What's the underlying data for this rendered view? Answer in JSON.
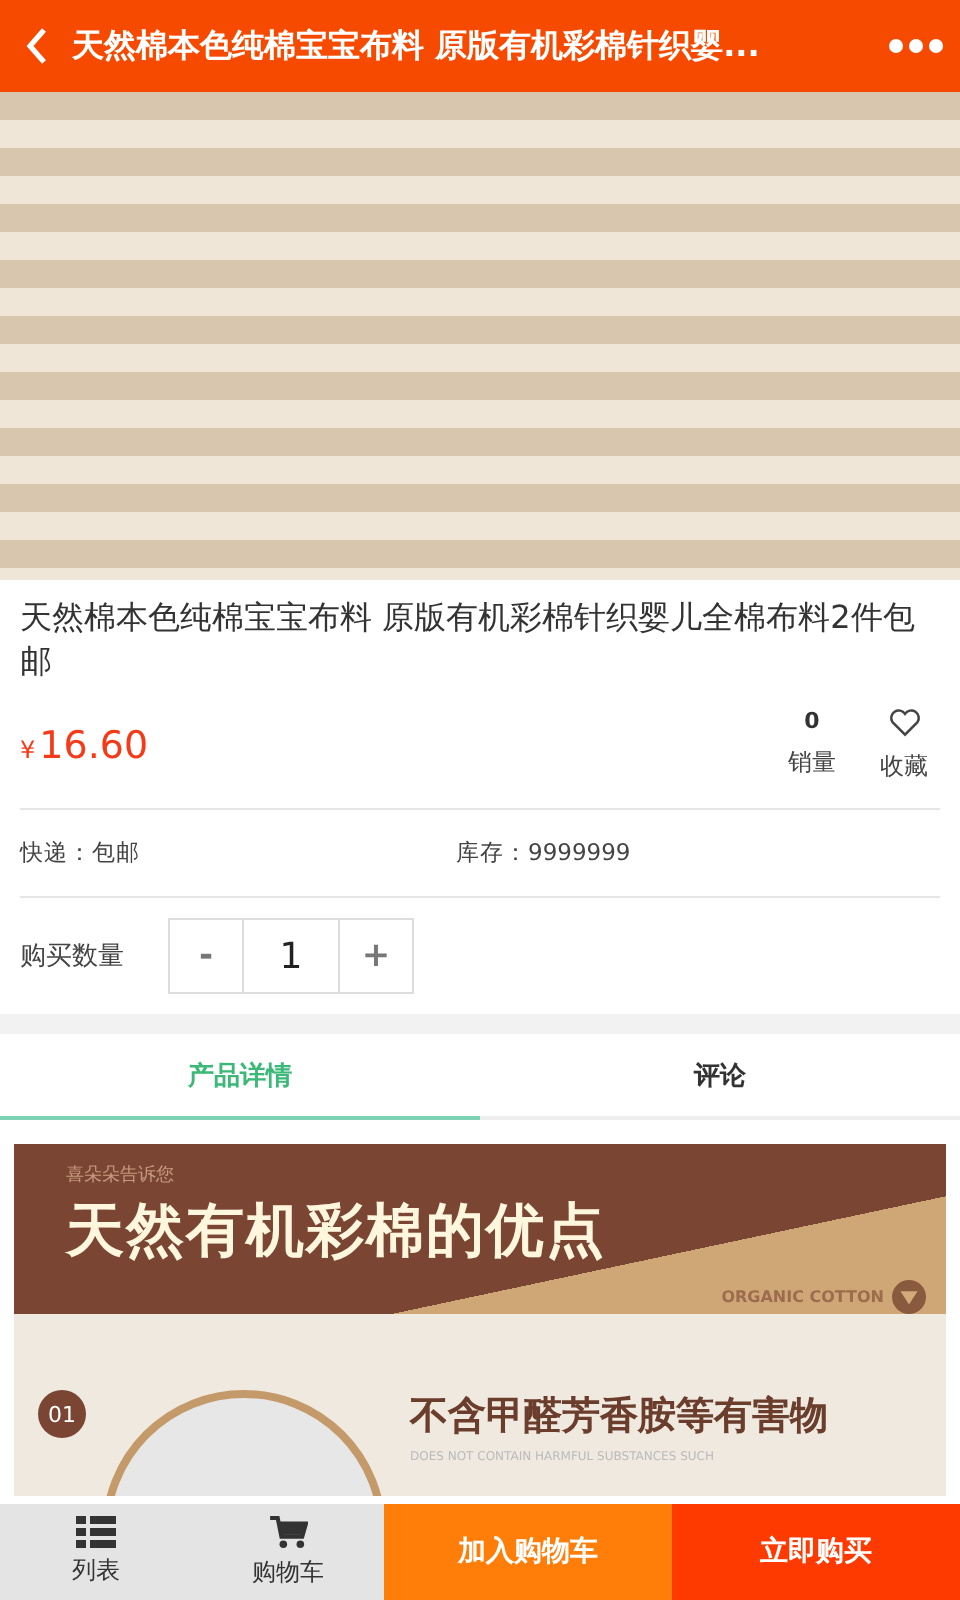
{
  "header": {
    "title": "天然棉本色纯棉宝宝布料 原版有机彩棉针织婴..."
  },
  "product": {
    "title": "天然棉本色纯棉宝宝布料 原版有机彩棉针织婴儿全棉布料2件包邮",
    "currency": "¥",
    "price": "16.60",
    "sales_count": "0",
    "sales_label": "销量",
    "favorite_label": "收藏",
    "favorited": false,
    "shipping": "快递：包邮",
    "stock": "库存：9999999"
  },
  "quantity": {
    "label": "购买数量",
    "minus": "-",
    "value": "1",
    "plus": "+"
  },
  "tabs": [
    {
      "label": "产品详情",
      "selected": true
    },
    {
      "label": "评论",
      "selected": false
    }
  ],
  "detail_banner": {
    "brand_line": "喜朵朵告诉您",
    "headline": "天然有机彩棉的优点",
    "tagline": "ORGANIC COTTON",
    "step": "01",
    "point_title": "不含甲醛芳香胺等有害物",
    "point_subtitle": "DOES NOT CONTAIN HARMFUL SUBSTANCES SUCH"
  },
  "bottom_bar": {
    "list_label": "列表",
    "cart_label": "购物车",
    "add_to_cart": "加入购物车",
    "buy_now": "立即购买"
  }
}
